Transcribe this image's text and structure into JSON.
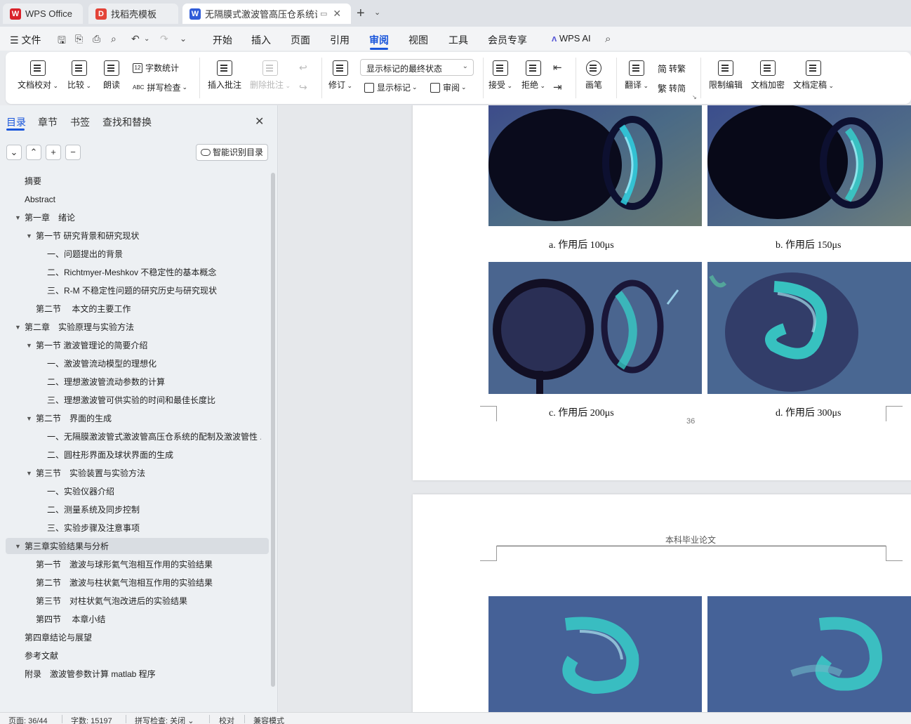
{
  "tabs": [
    {
      "label": "WPS Office",
      "logo": "W",
      "logo_color": "#d9222a"
    },
    {
      "label": "找稻壳模板",
      "logo": "D",
      "logo_color": "#e34338"
    },
    {
      "label": "无隔膜式激波管高压仓系统设",
      "logo": "W",
      "logo_color": "#2f5bd8"
    }
  ],
  "menu": {
    "file": "文件",
    "items": [
      "开始",
      "插入",
      "页面",
      "引用",
      "审阅",
      "视图",
      "工具",
      "会员专享"
    ],
    "active": "审阅",
    "wps_ai": "WPS AI"
  },
  "ribbon": {
    "doc_proof": "文档校对",
    "compare": "比较",
    "read_aloud": "朗读",
    "word_count": "字数统计",
    "spell_check": "拼写检查",
    "insert_comment": "插入批注",
    "delete_comment": "删除批注",
    "track_changes": "修订",
    "markup_state": "显示标记的最终状态",
    "show_markup": "显示标记",
    "review": "审阅",
    "accept": "接受",
    "reject": "拒绝",
    "pen": "画笔",
    "translate": "翻译",
    "to_traditional": "转繁",
    "to_simplified": "转简",
    "restrict_edit": "限制编辑",
    "encrypt": "文档加密",
    "finalize": "文档定稿"
  },
  "nav": {
    "tabs": [
      "目录",
      "章节",
      "书签",
      "查找和替换"
    ],
    "smart_toc": "智能识别目录",
    "toc": [
      {
        "text": "摘要",
        "level": 1,
        "arrow": false
      },
      {
        "text": "Abstract",
        "level": 1,
        "arrow": false
      },
      {
        "text": "第一章　绪论",
        "level": 1,
        "arrow": true
      },
      {
        "text": "第一节  研究背景和研究现状",
        "level": 2,
        "arrow": true
      },
      {
        "text": "一、问题提出的背景",
        "level": 3,
        "arrow": false
      },
      {
        "text": "二、Richtmyer-Meshkov 不稳定性的基本概念",
        "level": 3,
        "arrow": false
      },
      {
        "text": "三、R-M 不稳定性问题的研究历史与研究现状",
        "level": 3,
        "arrow": false
      },
      {
        "text": "第二节　  本文的主要工作",
        "level": 2,
        "arrow": false
      },
      {
        "text": "第二章　实验原理与实验方法",
        "level": 1,
        "arrow": true
      },
      {
        "text": "第一节  激波管理论的简要介绍",
        "level": 2,
        "arrow": true
      },
      {
        "text": "一、激波管流动模型的理想化",
        "level": 3,
        "arrow": false
      },
      {
        "text": "二、理想激波管流动参数的计算",
        "level": 3,
        "arrow": false
      },
      {
        "text": "三、理想激波管可供实验的时间和最佳长度比",
        "level": 3,
        "arrow": false
      },
      {
        "text": "第二节　界面的生成",
        "level": 2,
        "arrow": true
      },
      {
        "text": "一、无隔膜激波管式激波管高压仓系统的配制及激波管性 ...",
        "level": 3,
        "arrow": false
      },
      {
        "text": "二、圆柱形界面及球状界面的生成",
        "level": 3,
        "arrow": false
      },
      {
        "text": "第三节　实验装置与实验方法",
        "level": 2,
        "arrow": true
      },
      {
        "text": "一、实验仪器介绍",
        "level": 3,
        "arrow": false
      },
      {
        "text": "二、测量系统及同步控制",
        "level": 3,
        "arrow": false
      },
      {
        "text": "三、实验步骤及注意事项",
        "level": 3,
        "arrow": false
      },
      {
        "text": "第三章实验结果与分析",
        "level": 1,
        "arrow": true
      },
      {
        "text": "第一节　激波与球形氦气泡相互作用的实验结果",
        "level": 2,
        "arrow": false
      },
      {
        "text": "第二节　激波与柱状氦气泡相互作用的实验结果",
        "level": 2,
        "arrow": false
      },
      {
        "text": "第三节　对柱状氦气泡改进后的实验结果",
        "level": 2,
        "arrow": false
      },
      {
        "text": "第四节　  本章小结",
        "level": 2,
        "arrow": false
      },
      {
        "text": "第四章结论与展望",
        "level": 1,
        "arrow": false
      },
      {
        "text": "参考文献",
        "level": 1,
        "arrow": false
      },
      {
        "text": "附录　激波管参数计算 matlab 程序",
        "level": 1,
        "arrow": false
      }
    ],
    "selected_index": 20
  },
  "doc": {
    "captions": [
      "a. 作用后 100μs",
      "b. 作用后 150μs",
      "c. 作用后 200μs",
      "d. 作用后 300μs"
    ],
    "page_number": "36",
    "page2_header": "本科毕业论文"
  },
  "status": {
    "page": "页面: 36/44",
    "words": "字数: 15197",
    "spell": "拼写检查: 关闭",
    "proof": "校对",
    "compat": "兼容模式"
  },
  "colors": {
    "accent": "#1a56db"
  }
}
